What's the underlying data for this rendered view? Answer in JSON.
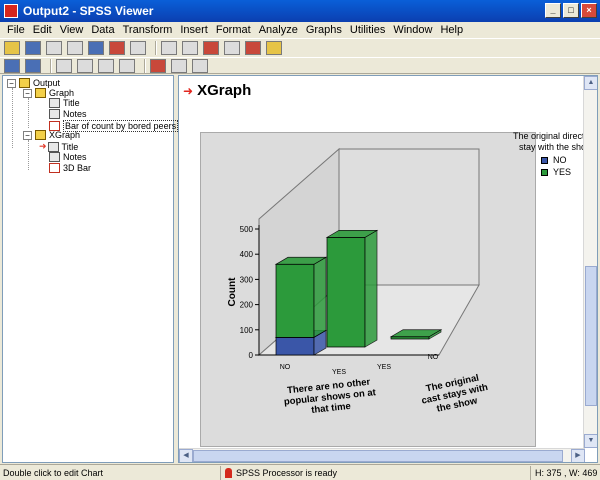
{
  "window": {
    "title": "Output2 - SPSS Viewer",
    "buttons": {
      "minimize": "_",
      "maximize": "□",
      "close": "×"
    }
  },
  "menu": [
    "File",
    "Edit",
    "View",
    "Data",
    "Transform",
    "Insert",
    "Format",
    "Analyze",
    "Graphs",
    "Utilities",
    "Window",
    "Help"
  ],
  "toolbar1_icons": [
    "open-icon",
    "save-icon",
    "print-icon",
    "print-preview-icon",
    "export-icon",
    "recall-dialog-icon",
    "undo-icon",
    "goto-case-icon",
    "variables-icon",
    "find-icon",
    "select-cases-icon",
    "value-labels-icon",
    "designate-window-icon"
  ],
  "toolbar2_icons": [
    "promote-icon",
    "demote-icon",
    "expand-icon",
    "collapse-icon",
    "show-icon",
    "hide-icon",
    "insert-heading-icon",
    "insert-title-icon",
    "insert-text-icon"
  ],
  "outline": {
    "root": "Output",
    "groups": [
      {
        "label": "Graph",
        "items": [
          "Title",
          "Notes",
          "Bar of count by bored peers"
        ]
      },
      {
        "label": "XGraph",
        "items": [
          "Title",
          "Notes",
          "3D Bar"
        ]
      }
    ],
    "expanders": {
      "root": "−",
      "group": "−"
    }
  },
  "content": {
    "heading_arrow": "➜",
    "heading": "XGraph",
    "legend": {
      "title_line1": "The original directo",
      "title_line2": "stay with the show",
      "items": [
        {
          "label": "NO",
          "color": "#3a56a8"
        },
        {
          "label": "YES",
          "color": "#2c9a3b"
        }
      ]
    }
  },
  "chart_data": {
    "type": "bar",
    "ylabel": "Count",
    "yticks": [
      "0",
      "100",
      "200",
      "300",
      "400",
      "500"
    ],
    "ylim": [
      0,
      500
    ],
    "categories": [
      "There are no other popular shows on at that time",
      "The original cast stays with the show"
    ],
    "category_label_lines": [
      [
        "There are no other",
        "popular shows on at",
        "that time"
      ],
      [
        "The original",
        "cast stays with",
        "the show"
      ]
    ],
    "sub_categories": [
      "NO",
      "YES",
      "YES",
      "NO"
    ],
    "series": [
      {
        "name": "NO",
        "values": [
          70,
          0
        ]
      },
      {
        "name": "YES",
        "values": [
          290,
          0
        ]
      }
    ],
    "depth_series": [
      {
        "name": "YES",
        "values": [
          435,
          5
        ]
      }
    ],
    "colors": {
      "NO": "#3a56a8",
      "YES": "#2c9a3b",
      "wall": "#d4d4d4",
      "floor": "#e6e6e6"
    }
  },
  "status": {
    "left": "Double click to edit Chart",
    "processor": "SPSS Processor  is ready",
    "dims": "H: 375 , W: 469"
  }
}
